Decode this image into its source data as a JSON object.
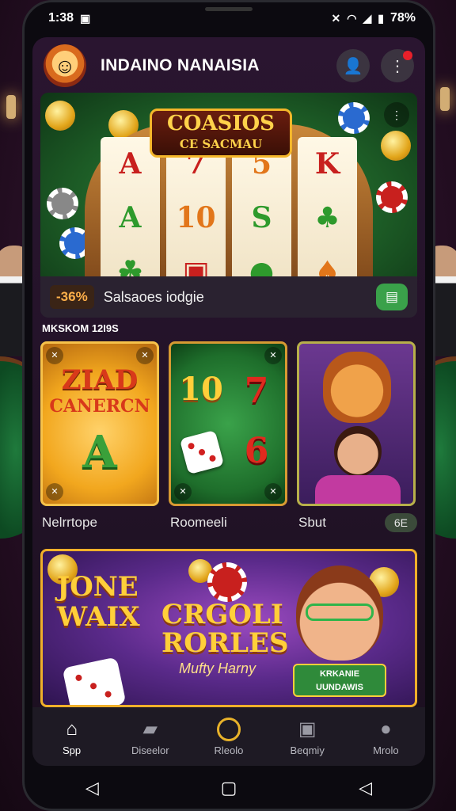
{
  "status_bar": {
    "time": "1:38",
    "battery": "78%"
  },
  "header": {
    "app_title": "INDAINO NANAISIA",
    "logo_icon": "jester-face-icon",
    "profile_icon": "user-icon",
    "notifications_icon": "bell-icon"
  },
  "hero": {
    "title_line1": "COASIOS",
    "title_line2": "CE SACMAU",
    "reels": [
      [
        "A",
        "A",
        "☘"
      ],
      [
        "7",
        "10",
        "▣"
      ],
      [
        "5",
        "S",
        "●"
      ],
      [
        "K",
        "♣",
        "♠"
      ]
    ]
  },
  "promo": {
    "badge": "-36%",
    "text": "Salsaoes iodgie"
  },
  "section_label": "MKSKOM 12I9S",
  "cards": [
    {
      "name": "Nelrrtope",
      "art_line1": "ZIAD",
      "art_line2": "CANERCN",
      "art_symbol": "A"
    },
    {
      "name": "Roomeeli",
      "art_num1": "10",
      "art_num2": "7",
      "art_num3": "6"
    },
    {
      "name": "Sbut"
    }
  ],
  "score_pill": "6E",
  "banner2": {
    "left_line1": "JONE",
    "left_line2": "WAIX",
    "center_line1": "CRGOLI",
    "center_line2": "RORLES",
    "subtitle": "Mufty Harny",
    "plaque_line1": "KRKANIE",
    "plaque_line2": "UUNDAWIS"
  },
  "bottom_nav": [
    {
      "label": "Spp",
      "icon": "home-icon",
      "active": true
    },
    {
      "label": "Diseelor",
      "icon": "cards-icon",
      "active": false
    },
    {
      "label": "Rleolo",
      "icon": "coin-ring-icon",
      "active": false
    },
    {
      "label": "Beqmiy",
      "icon": "wallet-icon",
      "active": false
    },
    {
      "label": "Mrolo",
      "icon": "user-icon",
      "active": false
    }
  ],
  "colors": {
    "accent_gold": "#f0b02a",
    "promo_green": "#3aa14a",
    "notification_red": "#e8202a"
  }
}
